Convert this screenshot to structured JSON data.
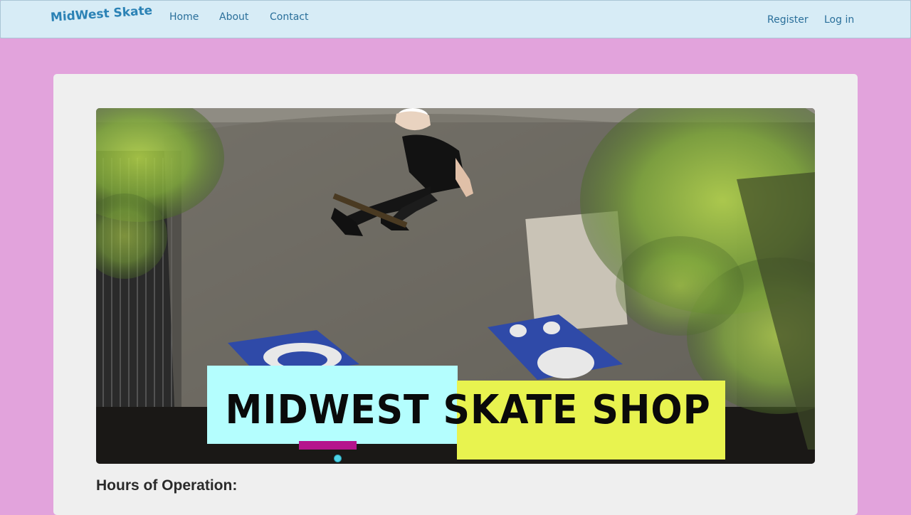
{
  "navbar": {
    "brand": "MidWest Skate",
    "links": [
      {
        "label": "Home"
      },
      {
        "label": "About"
      },
      {
        "label": "Contact"
      }
    ],
    "right_links": [
      {
        "label": "Register"
      },
      {
        "label": "Log in"
      }
    ]
  },
  "hero": {
    "banner_text": "MIDWEST SKATE SHOP",
    "colors": {
      "banner_left": "#b4fefe",
      "banner_right": "#e8f34f",
      "underline": "#b5148c",
      "active_dot": "#4fd3e6"
    }
  },
  "main": {
    "hours_heading": "Hours of Operation:"
  },
  "colors": {
    "page_background": "#e2a3dc",
    "navbar_background": "#d7ecf6",
    "link": "#2a6f9a",
    "brand": "#2b82b5",
    "card_background": "#efefef"
  }
}
